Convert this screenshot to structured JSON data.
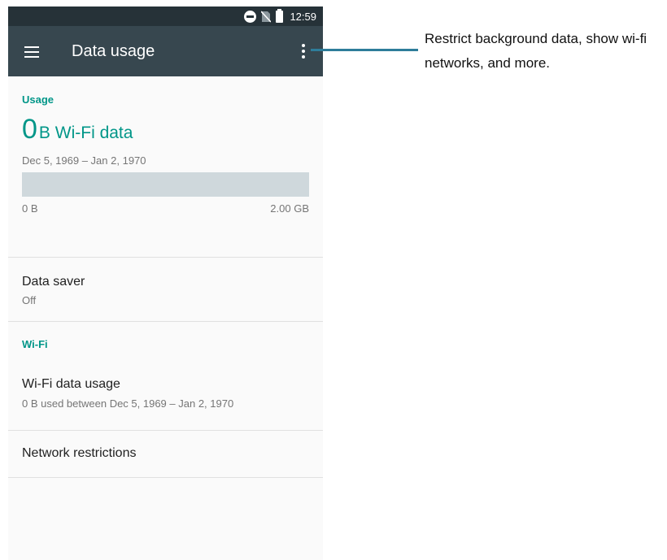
{
  "statusbar": {
    "time": "12:59",
    "icons": [
      "do-not-disturb-icon",
      "no-sim-icon",
      "battery-icon"
    ]
  },
  "toolbar": {
    "title": "Data usage",
    "menu_icon": "hamburger-menu-icon",
    "overflow_icon": "more-vert-icon"
  },
  "usage": {
    "section_label": "Usage",
    "amount_number": "0",
    "amount_unit": "B Wi-Fi data",
    "date_range": "Dec 5, 1969 – Jan 2, 1970",
    "bar_fill_fraction": 0,
    "axis_min": "0 B",
    "axis_max": "2.00 GB"
  },
  "data_saver": {
    "title": "Data saver",
    "summary": "Off"
  },
  "wifi": {
    "section_label": "Wi-Fi",
    "data_usage_title": "Wi-Fi data usage",
    "data_usage_summary": "0 B used between Dec 5, 1969 – Jan 2, 1970",
    "network_restrictions_title": "Network restrictions"
  },
  "annotation": {
    "text": "Restrict background data, show wi-fi networks, and more."
  },
  "colors": {
    "accent": "#009688",
    "toolbar": "#37474f",
    "statusbar": "#263238",
    "bar_track": "#cfd8dc",
    "callout_line": "#2e7d9a"
  }
}
